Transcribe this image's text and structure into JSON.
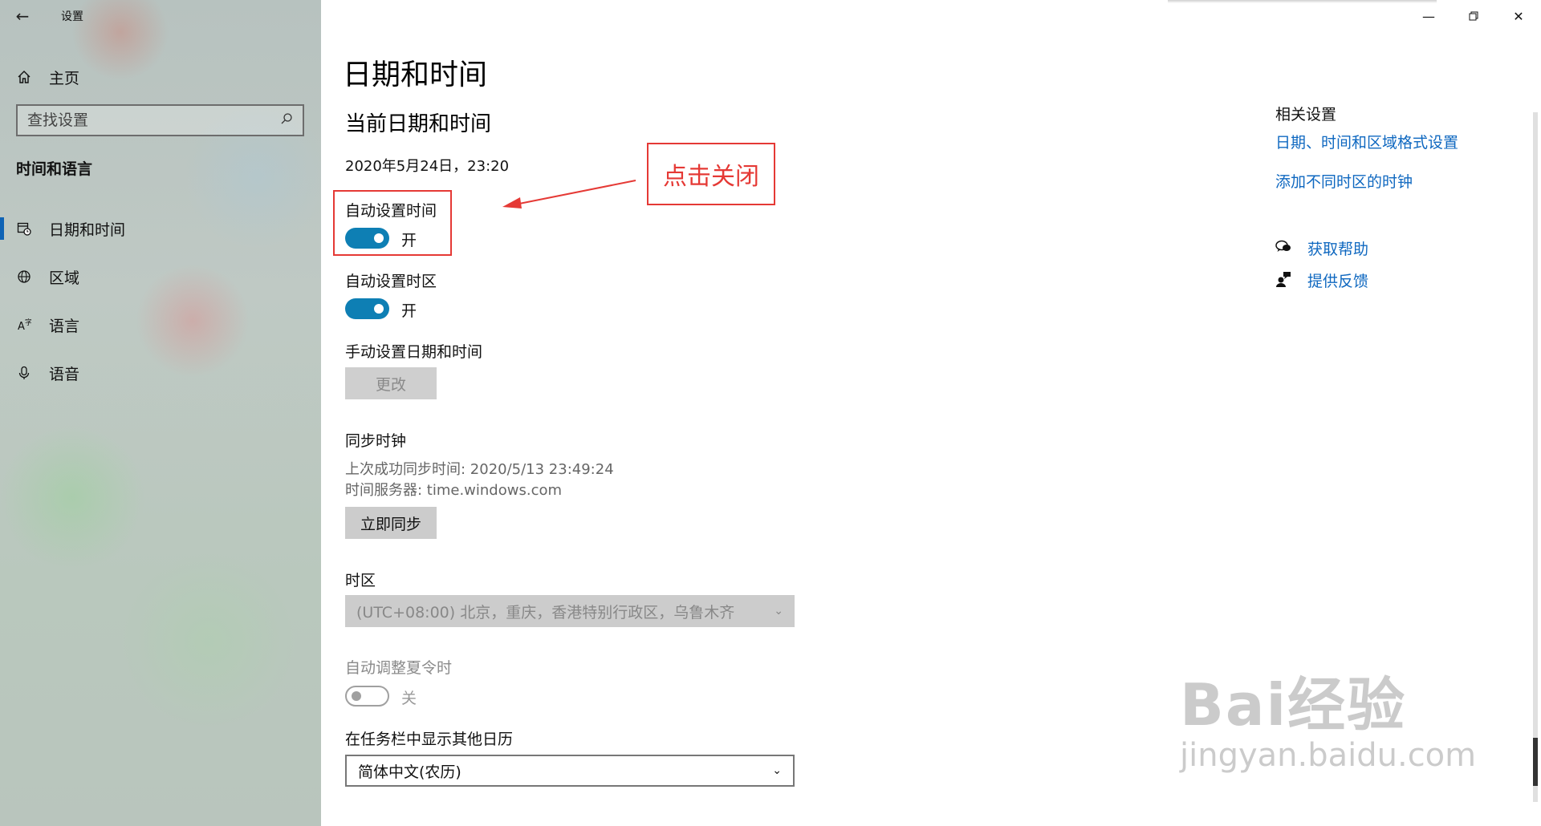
{
  "window": {
    "app_title": "设置"
  },
  "sidebar": {
    "home_label": "主页",
    "search_placeholder": "查找设置",
    "section_heading": "时间和语言",
    "items": [
      {
        "label": "日期和时间",
        "icon": "calendar-clock-icon",
        "active": true
      },
      {
        "label": "区域",
        "icon": "globe-icon",
        "active": false
      },
      {
        "label": "语言",
        "icon": "language-icon",
        "active": false
      },
      {
        "label": "语音",
        "icon": "microphone-icon",
        "active": false
      }
    ]
  },
  "main": {
    "page_title": "日期和时间",
    "sub_title": "当前日期和时间",
    "current_datetime": "2020年5月24日，23:20",
    "auto_time": {
      "label": "自动设置时间",
      "state_text": "开",
      "on": true
    },
    "auto_timezone": {
      "label": "自动设置时区",
      "state_text": "开",
      "on": true
    },
    "manual": {
      "label": "手动设置日期和时间",
      "button_label": "更改"
    },
    "sync": {
      "label": "同步时钟",
      "last_sync": "上次成功同步时间: 2020/5/13 23:49:24",
      "server": "时间服务器: time.windows.com",
      "button_label": "立即同步"
    },
    "timezone": {
      "label": "时区",
      "value": "(UTC+08:00) 北京，重庆，香港特别行政区，乌鲁木齐"
    },
    "dst": {
      "label": "自动调整夏令时",
      "state_text": "关",
      "on": false
    },
    "calendar": {
      "label": "在任务栏中显示其他日历",
      "value": "简体中文(农历)"
    }
  },
  "annotation": {
    "text": "点击关闭",
    "color": "#e53935"
  },
  "related": {
    "title": "相关设置",
    "links": [
      "日期、时间和区域格式设置",
      "添加不同时区的时钟"
    ],
    "help": {
      "get_help": "获取帮助",
      "feedback": "提供反馈"
    }
  },
  "watermark": {
    "brand": "Bai经验",
    "domain": "jingyan.baidu.com"
  },
  "colors": {
    "accent": "#0e7fb4",
    "link": "#0f68c0",
    "annotation": "#e53935"
  }
}
